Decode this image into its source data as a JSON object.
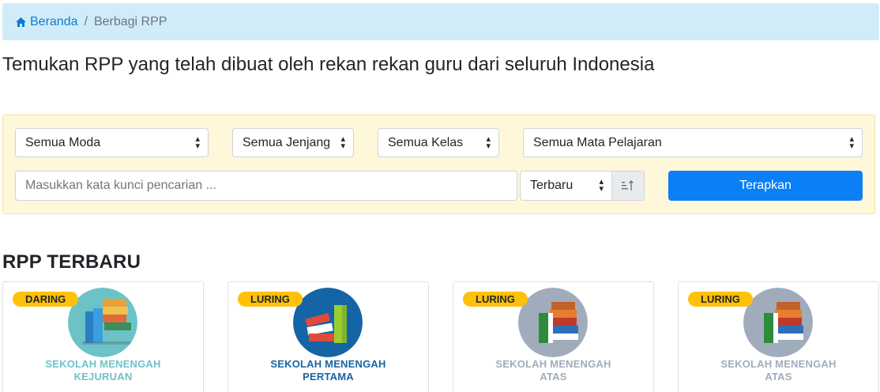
{
  "breadcrumb": {
    "home": "Beranda",
    "current": "Berbagi RPP"
  },
  "intro": "Temukan RPP yang telah dibuat oleh rekan rekan guru dari seluruh Indonesia",
  "filters": {
    "moda": "Semua Moda",
    "jenjang": "Semua Jenjang",
    "kelas": "Semua Kelas",
    "mapel": "Semua Mata Pelajaran",
    "search_placeholder": "Masukkan kata kunci pencarian ...",
    "sort": "Terbaru",
    "apply": "Terapkan"
  },
  "section_title": "RPP TERBARU",
  "cards": [
    {
      "badge": "DARING",
      "level_line1": "SEKOLAH MENENGAH",
      "level_line2": "KEJURUAN",
      "circle_color": "#6cc3c7",
      "text_color": "#6cc3c7"
    },
    {
      "badge": "LURING",
      "level_line1": "SEKOLAH MENENGAH",
      "level_line2": "PERTAMA",
      "circle_color": "#1565a6",
      "text_color": "#1565a6"
    },
    {
      "badge": "LURING",
      "level_line1": "SEKOLAH MENENGAH",
      "level_line2": "ATAS",
      "circle_color": "#a0acbb",
      "text_color": "#a0acbb"
    },
    {
      "badge": "LURING",
      "level_line1": "SEKOLAH MENENGAH",
      "level_line2": "ATAS",
      "circle_color": "#a0acbb",
      "text_color": "#a0acbb"
    }
  ],
  "colors": {
    "accent": "#0b7ff5",
    "badge": "#ffc107",
    "breadcrumb_bg": "#d1ecf9",
    "filter_bg": "#fff7da"
  }
}
